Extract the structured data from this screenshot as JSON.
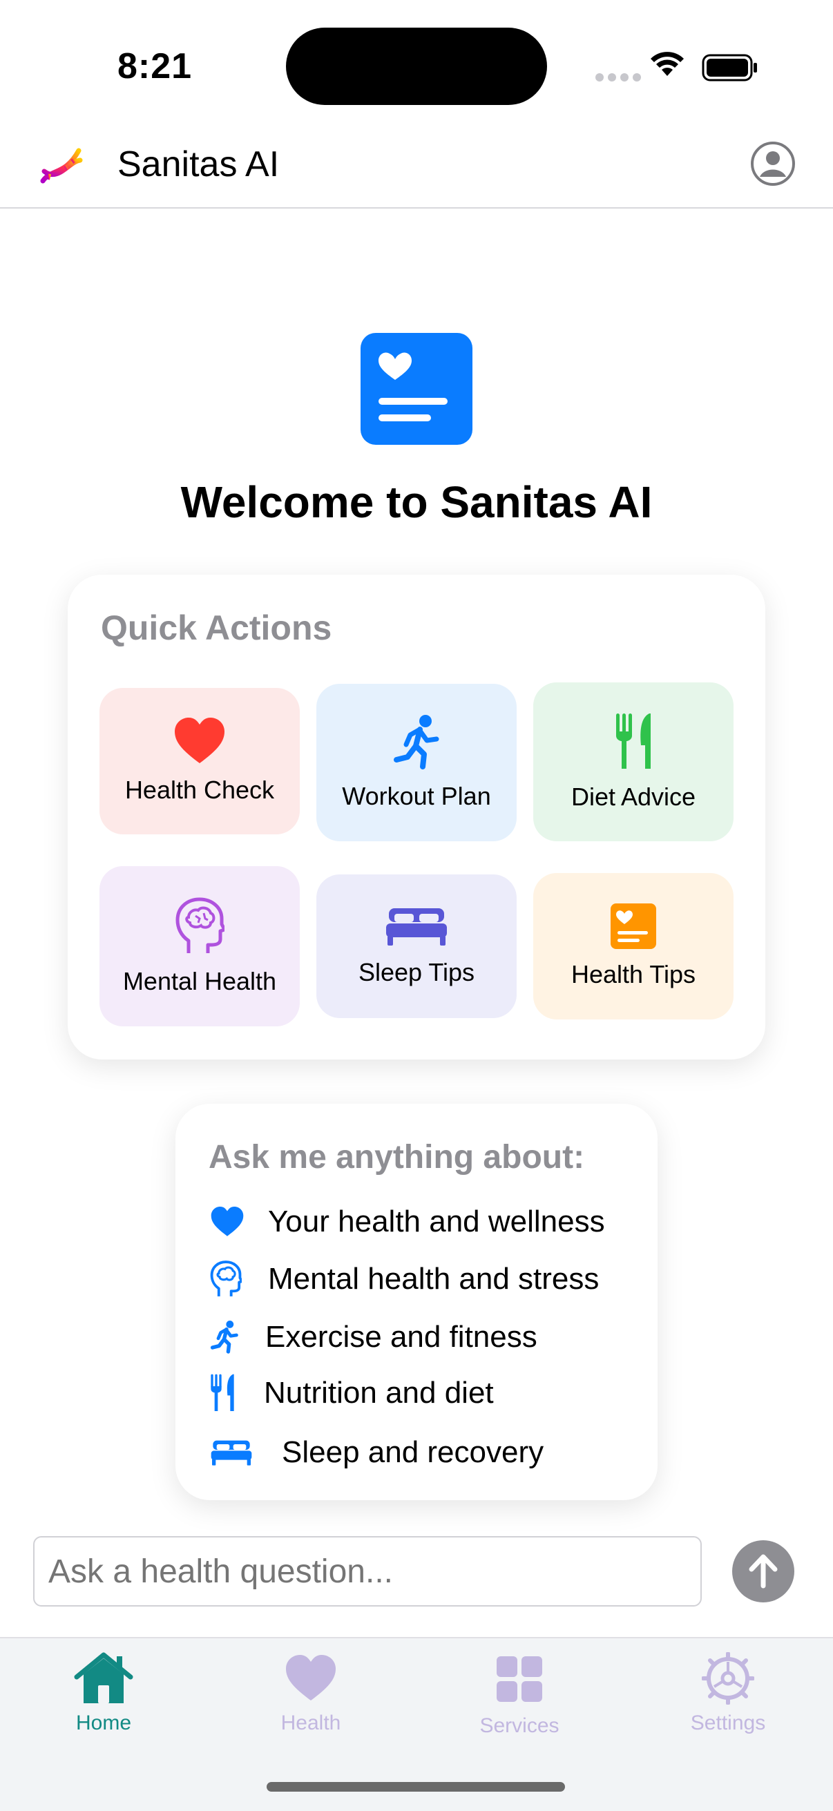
{
  "status_bar": {
    "time": "8:21"
  },
  "nav": {
    "title": "Sanitas AI",
    "logo_icon": "dna-icon",
    "profile_icon": "person-circle-icon"
  },
  "hero": {
    "icon": "medical-record-heart-icon",
    "welcome": "Welcome to Sanitas AI"
  },
  "quick_actions": {
    "title": "Quick Actions",
    "items": [
      {
        "label": "Health Check",
        "icon": "heart-icon",
        "bg": "#fde9e8",
        "color": "#ff3b30"
      },
      {
        "label": "Workout Plan",
        "icon": "running-figure-icon",
        "bg": "#e5f1fd",
        "color": "#0a7cff"
      },
      {
        "label": "Diet Advice",
        "icon": "fork-knife-icon",
        "bg": "#e6f6ea",
        "color": "#2fc24b"
      },
      {
        "label": "Mental Health",
        "icon": "brain-head-icon",
        "bg": "#f4ebfa",
        "color": "#af52de"
      },
      {
        "label": "Sleep Tips",
        "icon": "bed-icon",
        "bg": "#ececfa",
        "color": "#5856d6"
      },
      {
        "label": "Health Tips",
        "icon": "heart-note-icon",
        "bg": "#fff3e3",
        "color": "#ff9500"
      }
    ]
  },
  "ask": {
    "title": "Ask me anything about:",
    "items": [
      {
        "text": "Your health and wellness",
        "icon": "heart-icon"
      },
      {
        "text": "Mental health and stress",
        "icon": "brain-head-icon"
      },
      {
        "text": "Exercise and fitness",
        "icon": "running-figure-icon"
      },
      {
        "text": "Nutrition and diet",
        "icon": "fork-knife-icon"
      },
      {
        "text": "Sleep and recovery",
        "icon": "bed-icon"
      }
    ]
  },
  "input": {
    "placeholder": "Ask a health question...",
    "send_icon": "arrow-up-icon"
  },
  "tabs": [
    {
      "label": "Home",
      "icon": "house-icon",
      "active": true
    },
    {
      "label": "Health",
      "icon": "heart-icon",
      "active": false
    },
    {
      "label": "Services",
      "icon": "grid-icon",
      "active": false
    },
    {
      "label": "Settings",
      "icon": "gear-icon",
      "active": false
    }
  ],
  "colors": {
    "accent_blue": "#0a7cff",
    "tab_active": "#128a84",
    "tab_inactive": "#c2b7e0"
  }
}
